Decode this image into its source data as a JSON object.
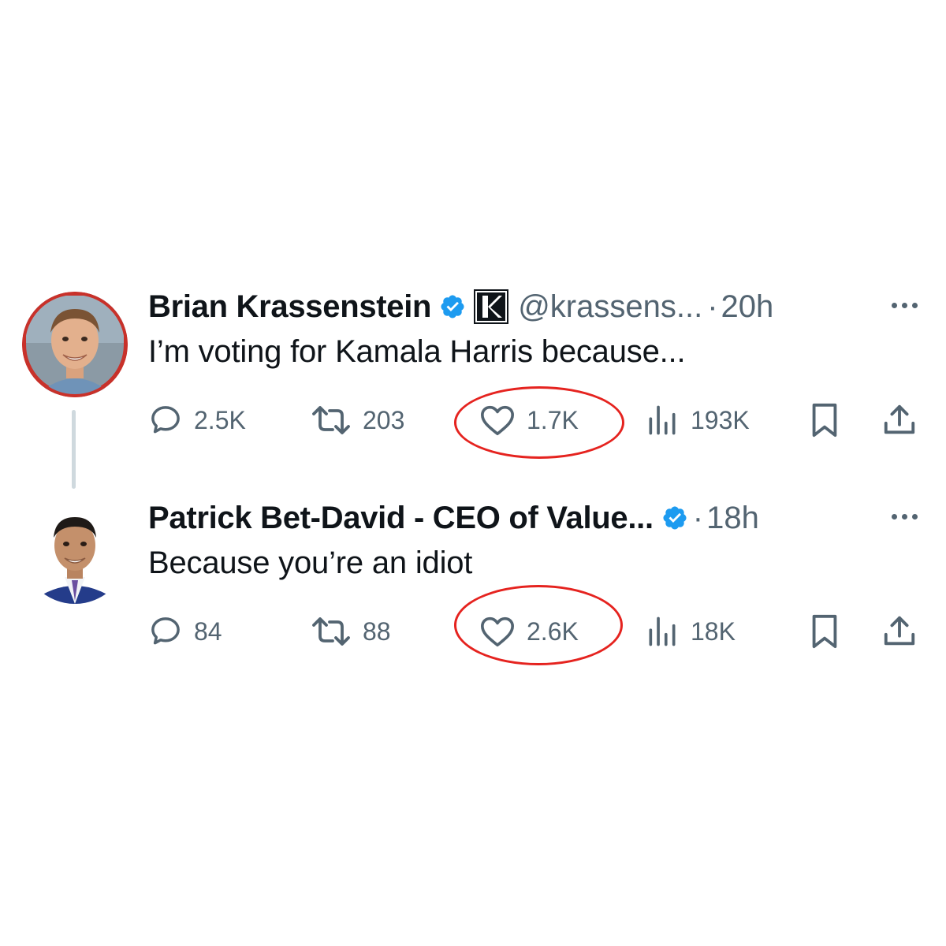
{
  "tweets": [
    {
      "name": "Brian Krassenstein",
      "handle": "@krassens...",
      "dot": "·",
      "time": "20h",
      "text": "I’m voting for Kamala Harris because...",
      "verified": true,
      "affiliate_badge": "K",
      "stats": {
        "replies": "2.5K",
        "reposts": "203",
        "likes": "1.7K",
        "views": "193K"
      }
    },
    {
      "name": "Patrick Bet-David - CEO of Value...",
      "dot": "·",
      "time": "18h",
      "text": "Because you’re an idiot",
      "verified": true,
      "stats": {
        "replies": "84",
        "reposts": "88",
        "likes": "2.6K",
        "views": "18K"
      }
    }
  ],
  "icons": {
    "reply": "speech-bubble-icon",
    "repost": "repost-arrows-icon",
    "like": "heart-outline-icon",
    "views": "bar-chart-icon",
    "bookmark": "bookmark-icon",
    "share": "share-upload-icon",
    "more": "more-dots-icon",
    "verified": "verified-badge-icon"
  },
  "colors": {
    "text_primary": "#0f1419",
    "text_secondary": "#536471",
    "verified_blue": "#1d9bf0",
    "annotation_red": "#e5231f",
    "thread_line": "#cfd9de"
  },
  "annotations": "red hand-drawn circles around both like counts"
}
